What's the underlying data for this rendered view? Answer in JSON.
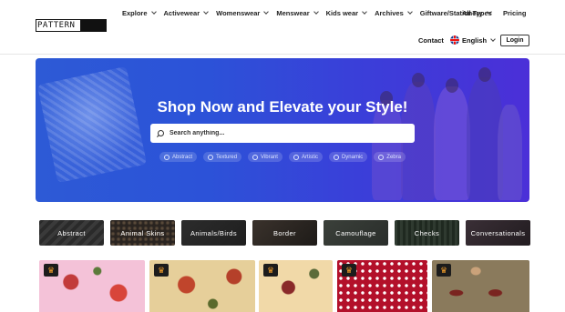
{
  "logo": {
    "text": "PATTERN"
  },
  "nav": {
    "items": [
      {
        "label": "Explore"
      },
      {
        "label": "Activewear"
      },
      {
        "label": "Womenswear"
      },
      {
        "label": "Menswear"
      },
      {
        "label": "Kids wear"
      },
      {
        "label": "Archives"
      },
      {
        "label": "Giftware/Stationery"
      }
    ],
    "all_types": "All Types",
    "pricing": "Pricing",
    "contact": "Contact",
    "language": "English",
    "login": "Login"
  },
  "hero": {
    "title": "Shop Now and Elevate your Style!",
    "search_placeholder": "Search anything...",
    "chips": [
      "Abstract",
      "Textured",
      "Vibrant",
      "Artistic",
      "Dynamic",
      "Zebra"
    ]
  },
  "categories": [
    "Abstract",
    "Animal Skins",
    "Animals/Birds",
    "Border",
    "Camouflage",
    "Checks",
    "Conversationals"
  ],
  "colors": {
    "hero_gradient_start": "#2d5ad6",
    "hero_gradient_end": "#4b2fd8",
    "crown": "#f29d2a"
  }
}
